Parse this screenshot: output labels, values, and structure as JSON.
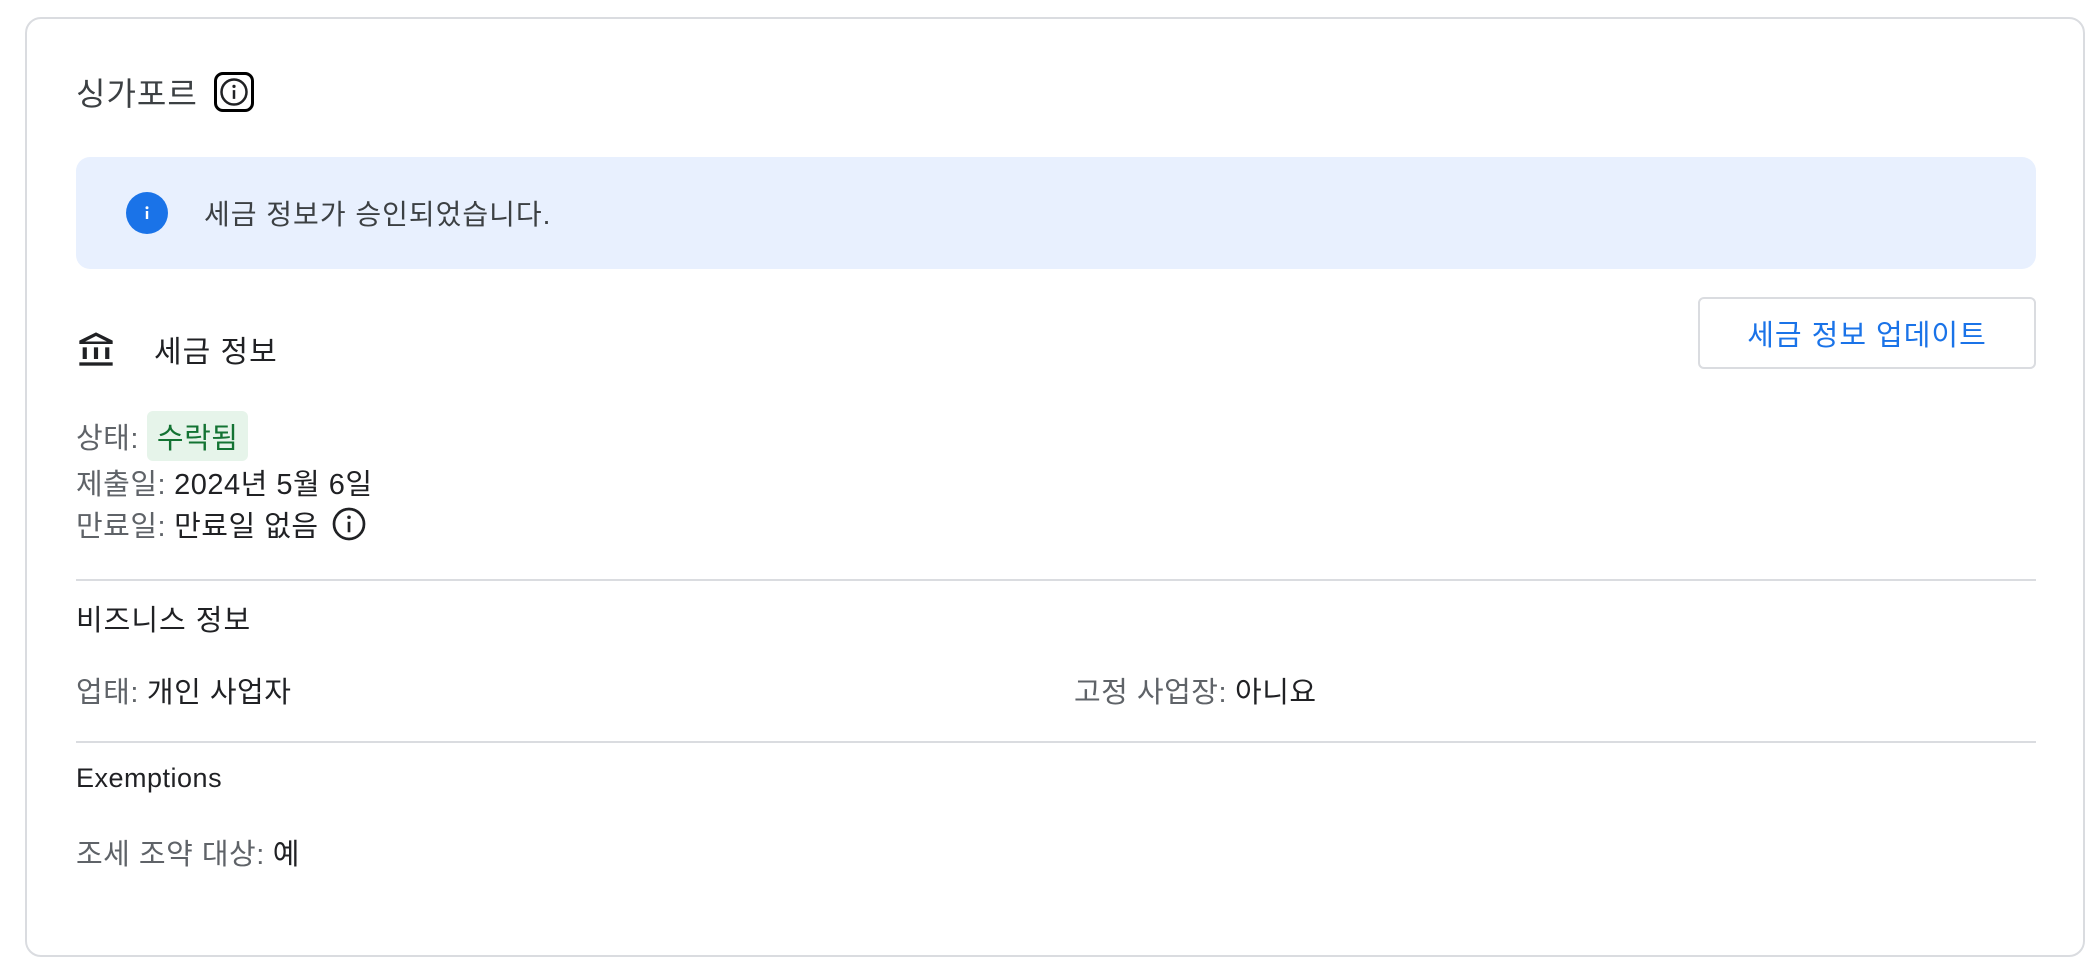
{
  "country": {
    "name": "싱가포르"
  },
  "banner": {
    "message": "세금 정보가 승인되었습니다."
  },
  "tax_info": {
    "title": "세금 정보",
    "update_button": "세금 정보 업데이트",
    "status_label": "상태:",
    "status_value": "수락됨",
    "submitted_label": "제출일:",
    "submitted_value": "2024년 5월 6일",
    "expiry_label": "만료일:",
    "expiry_value": "만료일 없음"
  },
  "business_info": {
    "title": "비즈니스 정보",
    "business_type_label": "업태:",
    "business_type_value": "개인 사업자",
    "fixed_place_label": "고정 사업장:",
    "fixed_place_value": "아니요"
  },
  "exemptions": {
    "title": "Exemptions",
    "treaty_label": "조세 조약 대상:",
    "treaty_value": "예"
  },
  "colors": {
    "accent": "#1a73e8",
    "banner_bg": "#e8f0fe",
    "status_chip_bg": "#e6f4ea",
    "status_chip_text": "#137333"
  },
  "icons": {
    "country_info": "info-icon",
    "banner": "info-filled-icon",
    "tax_section": "bank-icon",
    "expiry_info": "info-icon"
  }
}
